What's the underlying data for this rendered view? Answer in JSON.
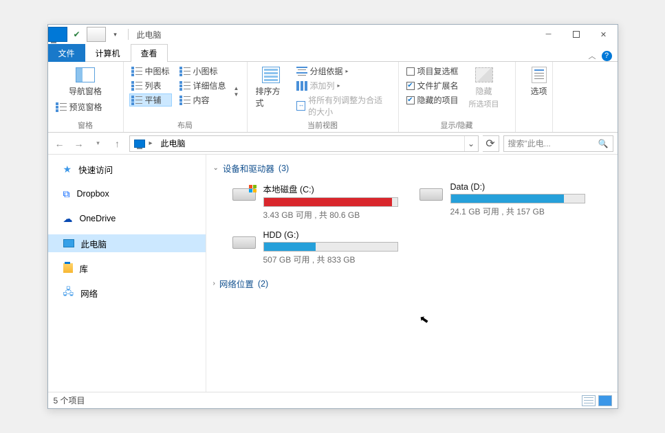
{
  "title": "此电脑",
  "tabs": {
    "file": "文件",
    "computer": "计算机",
    "view": "查看"
  },
  "ribbon": {
    "panes": {
      "nav": "导航窗格",
      "preview": "预览窗格",
      "lbl": "窗格"
    },
    "layout": {
      "medium": "中图标",
      "small": "小图标",
      "list": "列表",
      "details": "详细信息",
      "tiles": "平铺",
      "content": "内容",
      "lbl": "布局"
    },
    "view": {
      "sort": "排序方式",
      "group": "分组依据",
      "addcol": "添加列",
      "fit": "将所有列调整为合适的大小",
      "lbl": "当前视图"
    },
    "show": {
      "itemcb": "项目复选框",
      "ext": "文件扩展名",
      "hidden": "隐藏的项目",
      "hide": "隐藏",
      "hide2": "所选项目",
      "lbl": "显示/隐藏"
    },
    "options": "选项"
  },
  "address": {
    "location": "此电脑"
  },
  "search": {
    "placeholder": "搜索\"此电..."
  },
  "sidebar": [
    {
      "label": "快速访问"
    },
    {
      "label": "Dropbox"
    },
    {
      "label": "OneDrive"
    },
    {
      "label": "此电脑"
    },
    {
      "label": "库"
    },
    {
      "label": "网络"
    }
  ],
  "groups": {
    "devices": {
      "title": "设备和驱动器",
      "count": "(3)"
    },
    "network": {
      "title": "网络位置",
      "count": "(2)"
    }
  },
  "drives": [
    {
      "name": "本地磁盘 (C:)",
      "sub": "3.43 GB 可用 , 共 80.6 GB",
      "pct": 96,
      "color": "red",
      "win": true
    },
    {
      "name": "Data (D:)",
      "sub": "24.1 GB 可用 , 共 157 GB",
      "pct": 85,
      "color": "blue",
      "win": false
    },
    {
      "name": "HDD (G:)",
      "sub": "507 GB 可用 , 共 833 GB",
      "pct": 39,
      "color": "blue",
      "win": false
    }
  ],
  "status": {
    "text": "5 个项目"
  }
}
